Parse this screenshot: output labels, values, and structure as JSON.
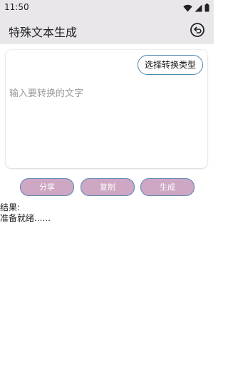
{
  "status_bar": {
    "time": "11:50",
    "icons": [
      "wifi-icon",
      "cellular-signal-icon",
      "battery-icon"
    ]
  },
  "app_bar": {
    "title": "特殊文本生成",
    "undo_icon": "undo-icon"
  },
  "input_card": {
    "type_button_label": "选择转换类型",
    "placeholder": "输入要转换的文字",
    "value": ""
  },
  "actions": {
    "share_label": "分享",
    "copy_label": "复制",
    "generate_label": "生成"
  },
  "result": {
    "label": "结果:",
    "text": "准备就绪......"
  },
  "colors": {
    "header_bg": "#e9e7ea",
    "button_fill": "#cda7c3",
    "button_border": "#5c86b0",
    "type_button_border": "#4c89b0"
  }
}
